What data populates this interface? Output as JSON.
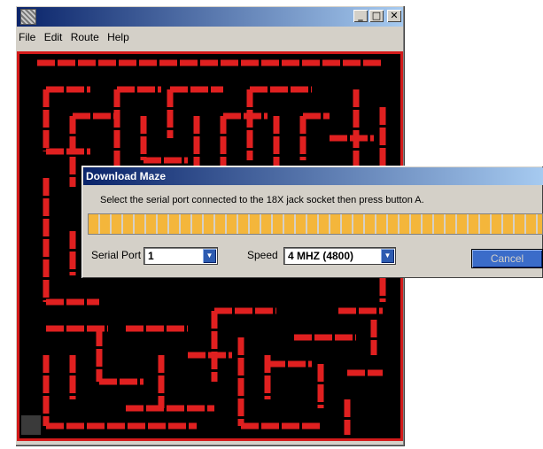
{
  "window": {
    "menu": [
      "File",
      "Edit",
      "Route",
      "Help"
    ],
    "controls": {
      "minimize": "_",
      "maximize": "□",
      "close": "✕"
    },
    "app_icon": "maze-app-icon"
  },
  "maze": {
    "wall_color": "#e02020",
    "floor_color": "#000000",
    "border_color": "#d41a1a"
  },
  "dialog": {
    "title": "Download Maze",
    "message": "Select the serial port connected to the 18X jack socket then press button A.",
    "progress": 1.0,
    "serial_port_label": "Serial Port",
    "serial_port_value": "1",
    "speed_label": "Speed",
    "speed_value": "4 MHZ (4800)",
    "cancel_label": "Cancel",
    "dropdown_arrow": "▼"
  }
}
